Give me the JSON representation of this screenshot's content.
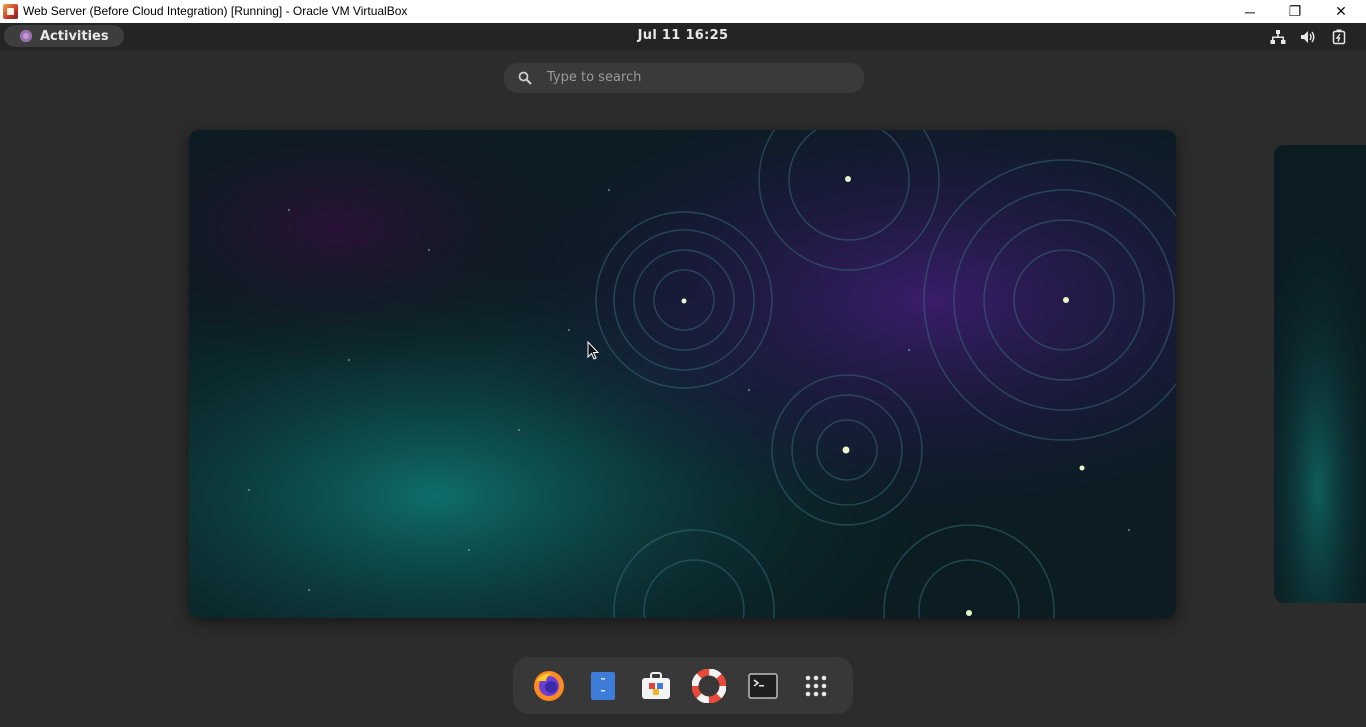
{
  "host_window": {
    "title": "Web Server (Before Cloud Integration) [Running] - Oracle VM VirtualBox",
    "controls": {
      "minimize": "─",
      "restore": "❐",
      "close": "✕"
    }
  },
  "topbar": {
    "activities_label": "Activities",
    "clock": "Jul 11  16:25",
    "tray_icons": [
      "network-icon",
      "volume-icon",
      "power-icon"
    ]
  },
  "search": {
    "placeholder": "Type to search"
  },
  "dash": {
    "apps": [
      "firefox-icon",
      "files-icon",
      "software-icon",
      "help-icon",
      "terminal-icon",
      "show-apps-icon"
    ]
  },
  "colors": {
    "background": "#2c2c2c",
    "topbar": "#242424",
    "dash": "#383838",
    "search": "#3a3a3a"
  }
}
